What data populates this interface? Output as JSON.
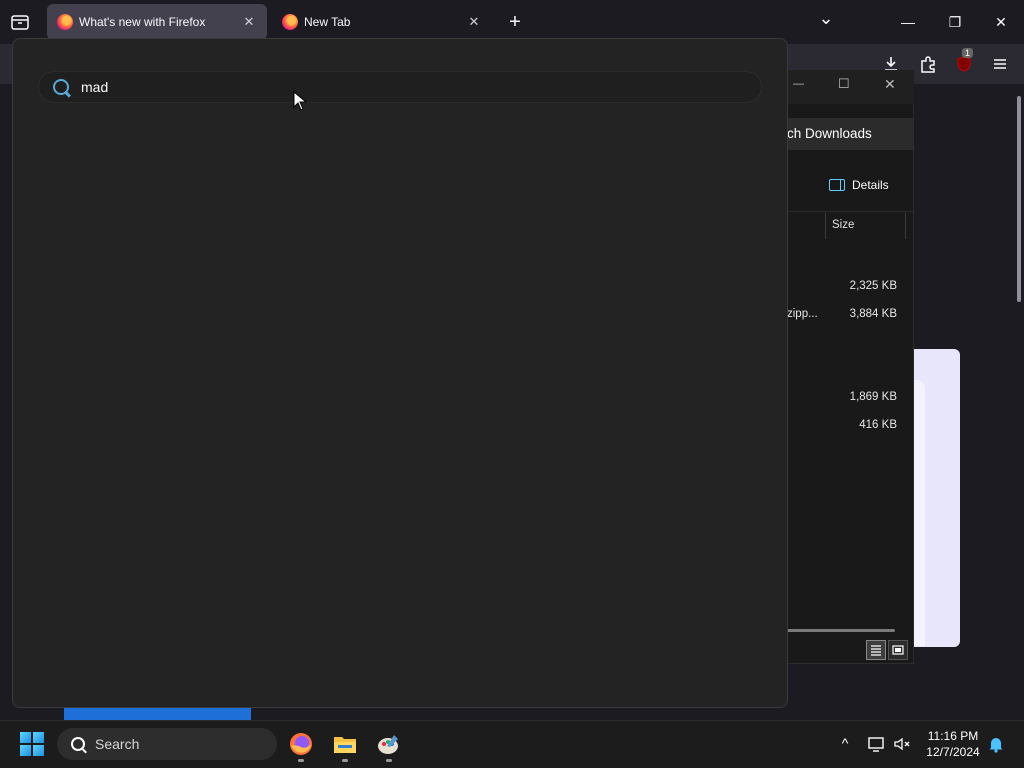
{
  "browser": {
    "tabs": [
      {
        "title": "What's new with Firefox",
        "close": "✕"
      },
      {
        "title": "New Tab",
        "close": "✕"
      }
    ],
    "new_tab_glyph": "+",
    "list_tabs_glyph": "⌄",
    "window_controls": {
      "minimize": "—",
      "maximize": "❐",
      "close": "✕"
    },
    "extension_badge": "1"
  },
  "tab_search": {
    "query": "mad"
  },
  "explorer": {
    "tab_label": "ch Downloads",
    "details_label": "Details",
    "column_size": "Size",
    "rows": [
      {
        "name": "",
        "size": "2,325 KB"
      },
      {
        "name": "zipp...",
        "size": "3,884 KB"
      },
      {
        "name": "",
        "size": "1,869 KB"
      },
      {
        "name": "",
        "size": "416 KB"
      }
    ],
    "title_controls": {
      "minimize": "—",
      "maximize": "☐",
      "close": "✕"
    }
  },
  "taskbar": {
    "search_label": "Search",
    "time": "11:16 PM",
    "date": "12/7/2024",
    "tray_chevron": "^"
  }
}
